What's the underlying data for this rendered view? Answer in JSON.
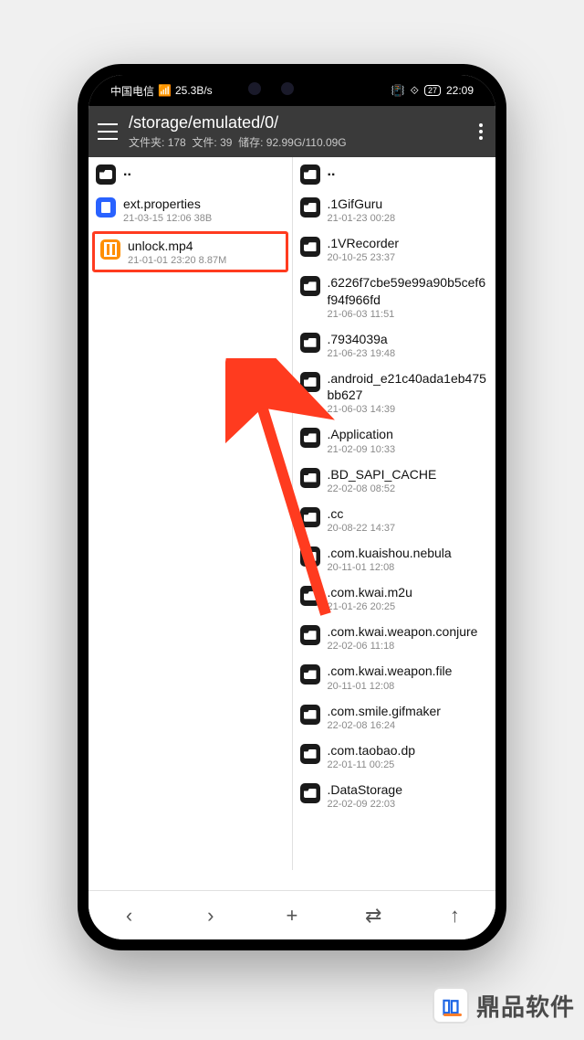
{
  "status": {
    "carrier": "中国电信",
    "speed": "25.3B/s",
    "battery": "27",
    "time": "22:09"
  },
  "header": {
    "path": "/storage/emulated/0/",
    "sub_prefix_folders": "文件夹:",
    "folder_count": "178",
    "sub_files": "文件:",
    "file_count": "39",
    "sub_storage": "储存:",
    "storage_val": "92.99G/110.09G"
  },
  "left_pane": {
    "parent": "..",
    "items": [
      {
        "icon": "doc",
        "name": "ext.properties",
        "meta": "21-03-15 12:06  38B",
        "highlight": false
      },
      {
        "icon": "vid",
        "name": "unlock.mp4",
        "meta": "21-01-01 23:20  8.87M",
        "highlight": true
      }
    ]
  },
  "right_pane": {
    "parent": "..",
    "items": [
      {
        "name": ".1GifGuru",
        "meta": "21-01-23 00:28"
      },
      {
        "name": ".1VRecorder",
        "meta": "20-10-25 23:37"
      },
      {
        "name": ".6226f7cbe59e99a90b5cef6f94f966fd",
        "meta": "21-06-03 11:51"
      },
      {
        "name": ".7934039a",
        "meta": "21-06-23 19:48"
      },
      {
        "name": ".android_e21c40ada1eb475bb627",
        "meta": "21-06-03 14:39"
      },
      {
        "name": ".Application",
        "meta": "21-02-09 10:33"
      },
      {
        "name": ".BD_SAPI_CACHE",
        "meta": "22-02-08 08:52"
      },
      {
        "name": ".cc",
        "meta": "20-08-22 14:37"
      },
      {
        "name": ".com.kuaishou.nebula",
        "meta": "20-11-01 12:08"
      },
      {
        "name": ".com.kwai.m2u",
        "meta": "21-01-26 20:25"
      },
      {
        "name": ".com.kwai.weapon.conjure",
        "meta": "22-02-06 11:18"
      },
      {
        "name": ".com.kwai.weapon.file",
        "meta": "20-11-01 12:08"
      },
      {
        "name": ".com.smile.gifmaker",
        "meta": "22-02-08 16:24"
      },
      {
        "name": ".com.taobao.dp",
        "meta": "22-01-11 00:25"
      },
      {
        "name": ".DataStorage",
        "meta": "22-02-09 22:03"
      }
    ]
  },
  "nav": {
    "back": "‹",
    "forward": "›",
    "add": "+",
    "swap": "⇄",
    "up": "↑"
  },
  "watermark": {
    "logo": "吅",
    "text": "鼎品软件"
  }
}
